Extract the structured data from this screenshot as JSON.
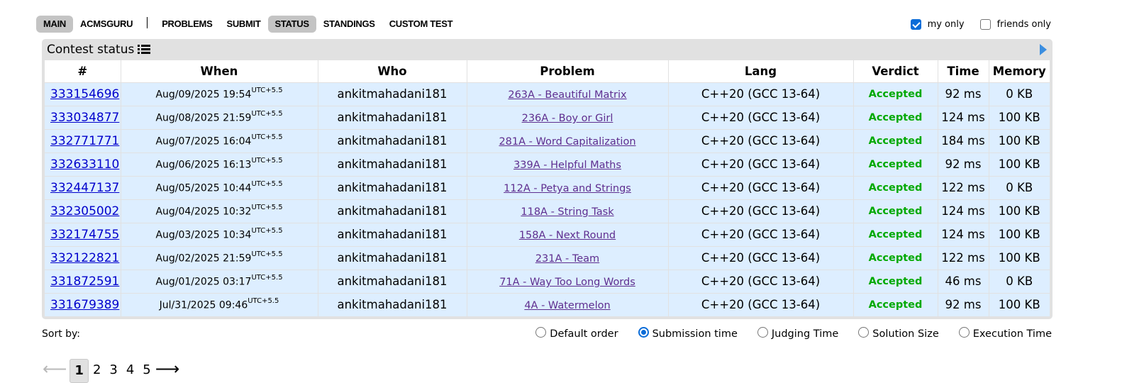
{
  "menu": {
    "items": [
      {
        "label": "MAIN",
        "active": true
      },
      {
        "label": "ACMSGURU",
        "active": false
      },
      {
        "label": "PROBLEMS",
        "active": false
      },
      {
        "label": "SUBMIT",
        "active": false
      },
      {
        "label": "STATUS",
        "active": true
      },
      {
        "label": "STANDINGS",
        "active": false
      },
      {
        "label": "CUSTOM TEST",
        "active": false
      }
    ]
  },
  "filters": {
    "my_only": {
      "label": "my only",
      "checked": true
    },
    "friends_only": {
      "label": "friends only",
      "checked": false
    }
  },
  "panel": {
    "title": "Contest status",
    "title_icon": "list-icon",
    "expand_icon": "arrow-right-icon"
  },
  "table": {
    "headers": [
      "#",
      "When",
      "Who",
      "Problem",
      "Lang",
      "Verdict",
      "Time",
      "Memory"
    ],
    "rows": [
      {
        "id": "333154696",
        "when": "Aug/09/2025 19:54",
        "tz": "UTC+5.5",
        "who": "ankitmahadani181",
        "problem": "263A - Beautiful Matrix",
        "lang": "C++20 (GCC 13-64)",
        "verdict": "Accepted",
        "time": "92 ms",
        "memory": "0 KB"
      },
      {
        "id": "333034877",
        "when": "Aug/08/2025 21:59",
        "tz": "UTC+5.5",
        "who": "ankitmahadani181",
        "problem": "236A - Boy or Girl",
        "lang": "C++20 (GCC 13-64)",
        "verdict": "Accepted",
        "time": "124 ms",
        "memory": "100 KB"
      },
      {
        "id": "332771771",
        "when": "Aug/07/2025 16:04",
        "tz": "UTC+5.5",
        "who": "ankitmahadani181",
        "problem": "281A - Word Capitalization",
        "lang": "C++20 (GCC 13-64)",
        "verdict": "Accepted",
        "time": "184 ms",
        "memory": "100 KB"
      },
      {
        "id": "332633110",
        "when": "Aug/06/2025 16:13",
        "tz": "UTC+5.5",
        "who": "ankitmahadani181",
        "problem": "339A - Helpful Maths",
        "lang": "C++20 (GCC 13-64)",
        "verdict": "Accepted",
        "time": "92 ms",
        "memory": "100 KB"
      },
      {
        "id": "332447137",
        "when": "Aug/05/2025 10:44",
        "tz": "UTC+5.5",
        "who": "ankitmahadani181",
        "problem": "112A - Petya and Strings",
        "lang": "C++20 (GCC 13-64)",
        "verdict": "Accepted",
        "time": "122 ms",
        "memory": "0 KB"
      },
      {
        "id": "332305002",
        "when": "Aug/04/2025 10:32",
        "tz": "UTC+5.5",
        "who": "ankitmahadani181",
        "problem": "118A - String Task",
        "lang": "C++20 (GCC 13-64)",
        "verdict": "Accepted",
        "time": "124 ms",
        "memory": "100 KB"
      },
      {
        "id": "332174755",
        "when": "Aug/03/2025 10:34",
        "tz": "UTC+5.5",
        "who": "ankitmahadani181",
        "problem": "158A - Next Round",
        "lang": "C++20 (GCC 13-64)",
        "verdict": "Accepted",
        "time": "124 ms",
        "memory": "100 KB"
      },
      {
        "id": "332122821",
        "when": "Aug/02/2025 21:59",
        "tz": "UTC+5.5",
        "who": "ankitmahadani181",
        "problem": "231A - Team",
        "lang": "C++20 (GCC 13-64)",
        "verdict": "Accepted",
        "time": "122 ms",
        "memory": "100 KB"
      },
      {
        "id": "331872591",
        "when": "Aug/01/2025 03:17",
        "tz": "UTC+5.5",
        "who": "ankitmahadani181",
        "problem": "71A - Way Too Long Words",
        "lang": "C++20 (GCC 13-64)",
        "verdict": "Accepted",
        "time": "46 ms",
        "memory": "0 KB"
      },
      {
        "id": "331679389",
        "when": "Jul/31/2025 09:46",
        "tz": "UTC+5.5",
        "who": "ankitmahadani181",
        "problem": "4A - Watermelon",
        "lang": "C++20 (GCC 13-64)",
        "verdict": "Accepted",
        "time": "92 ms",
        "memory": "100 KB"
      }
    ]
  },
  "sort": {
    "label": "Sort by:",
    "options": [
      {
        "label": "Default order",
        "checked": false
      },
      {
        "label": "Submission time",
        "checked": true
      },
      {
        "label": "Judging Time",
        "checked": false
      },
      {
        "label": "Solution Size",
        "checked": false
      },
      {
        "label": "Execution Time",
        "checked": false
      }
    ]
  },
  "pagination": {
    "prev": "⟵",
    "next": "⟶",
    "pages": [
      "1",
      "2",
      "3",
      "4",
      "5"
    ],
    "current": "1"
  },
  "colors": {
    "row_bg": "#ddeeff",
    "panel_bg": "#e1e1e1",
    "link": "#0000cc",
    "problem_link": "#5e2e8f",
    "accepted": "#00a900",
    "accent": "#0b6cd8"
  }
}
